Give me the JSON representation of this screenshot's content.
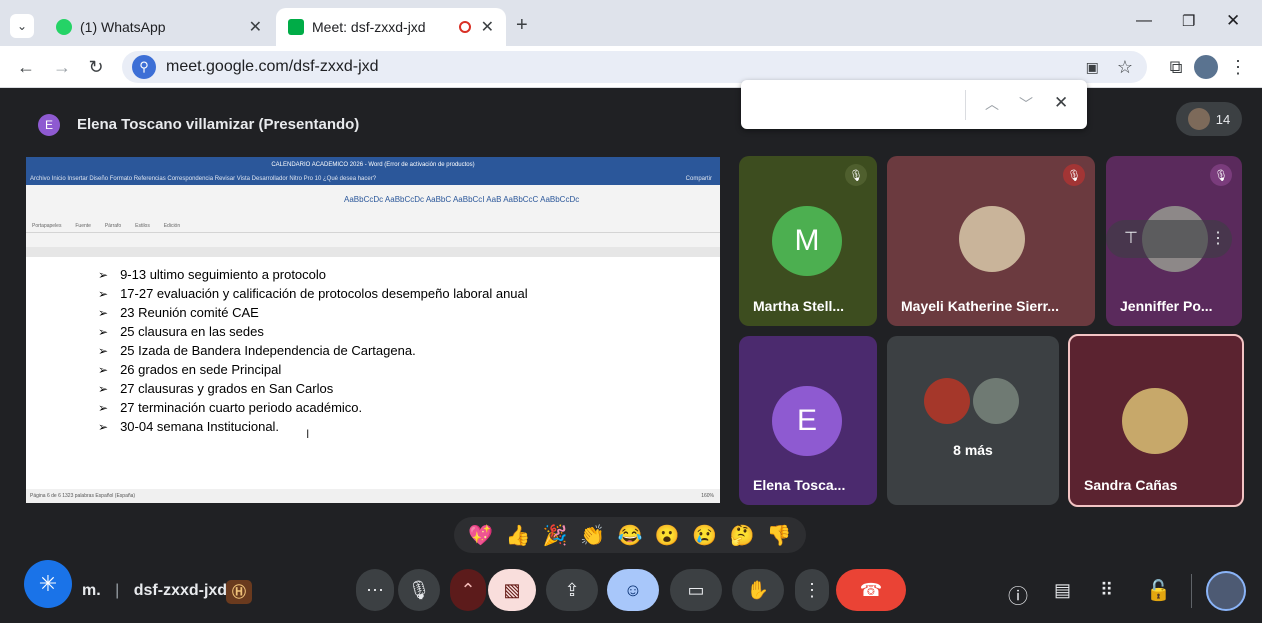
{
  "tabs": [
    {
      "label": "(1) WhatsApp",
      "active": false
    },
    {
      "label": "Meet: dsf-zxxd-jxd",
      "active": true
    }
  ],
  "address": {
    "url": "meet.google.com/dsf-zxxd-jxd"
  },
  "presenter": {
    "initial": "E",
    "label": "Elena Toscano villamizar (Presentando)"
  },
  "people_count": "14",
  "word": {
    "title": "CALENDARIO ACADEMICO 2026 - Word (Error de activación de productos)",
    "tabs": "Archivo   Inicio   Insertar   Diseño   Formato   Referencias   Correspondencia   Revisar   Vista   Desarrollador   Nitro Pro 10   ¿Qué desea hacer?",
    "share": "Compartir",
    "ribbon_styles": "AaBbCcDc  AaBbCcDc  AaBbC  AaBbCcI  AaB  AaBbCcC  AaBbCcDc",
    "ribbon_groups": "Portapapeles          Fuente          Párrafo          Estilos          Edición",
    "status": "Página 6 de 6   1323 palabras   Español (España)",
    "zoom": "160%",
    "lines": [
      "9-13 ultimo seguimiento a protocolo",
      "17-27 evaluación y calificación de protocolos desempeño laboral anual",
      "23 Reunión comité CAE",
      "25 clausura en las sedes",
      "25 Izada de Bandera Independencia de Cartagena.",
      "26 grados en sede Principal",
      "27 clausuras y grados en San Carlos",
      "27 terminación cuarto periodo académico.",
      "30-04 semana Institucional."
    ]
  },
  "participants": [
    {
      "name": "Martha Stell...",
      "initial": "M"
    },
    {
      "name": "Mayeli Katherine Sierr..."
    },
    {
      "name": "Jenniffer Po..."
    },
    {
      "name": "Elena Tosca...",
      "initial": "E"
    },
    {
      "name": "8 más"
    },
    {
      "name": "Sandra Cañas"
    }
  ],
  "reactions": [
    "💖",
    "👍",
    "🎉",
    "👏",
    "😂",
    "😮",
    "😢",
    "🤔",
    "👎"
  ],
  "bottom": {
    "code_prefix": "m.",
    "meeting_code": "dsf-zxxd-jxd"
  },
  "colors": {
    "martha_tile": "#3d4d1f",
    "mayeli_tile": "#6b3a3f",
    "jenniffer_tile": "#5a2a5c",
    "elena_tile": "#4b2a6e",
    "more_tile": "#3c4043",
    "sandra_tile": "#5b2330",
    "end_call": "#ea4335",
    "active_btn": "#a8c7fa"
  }
}
